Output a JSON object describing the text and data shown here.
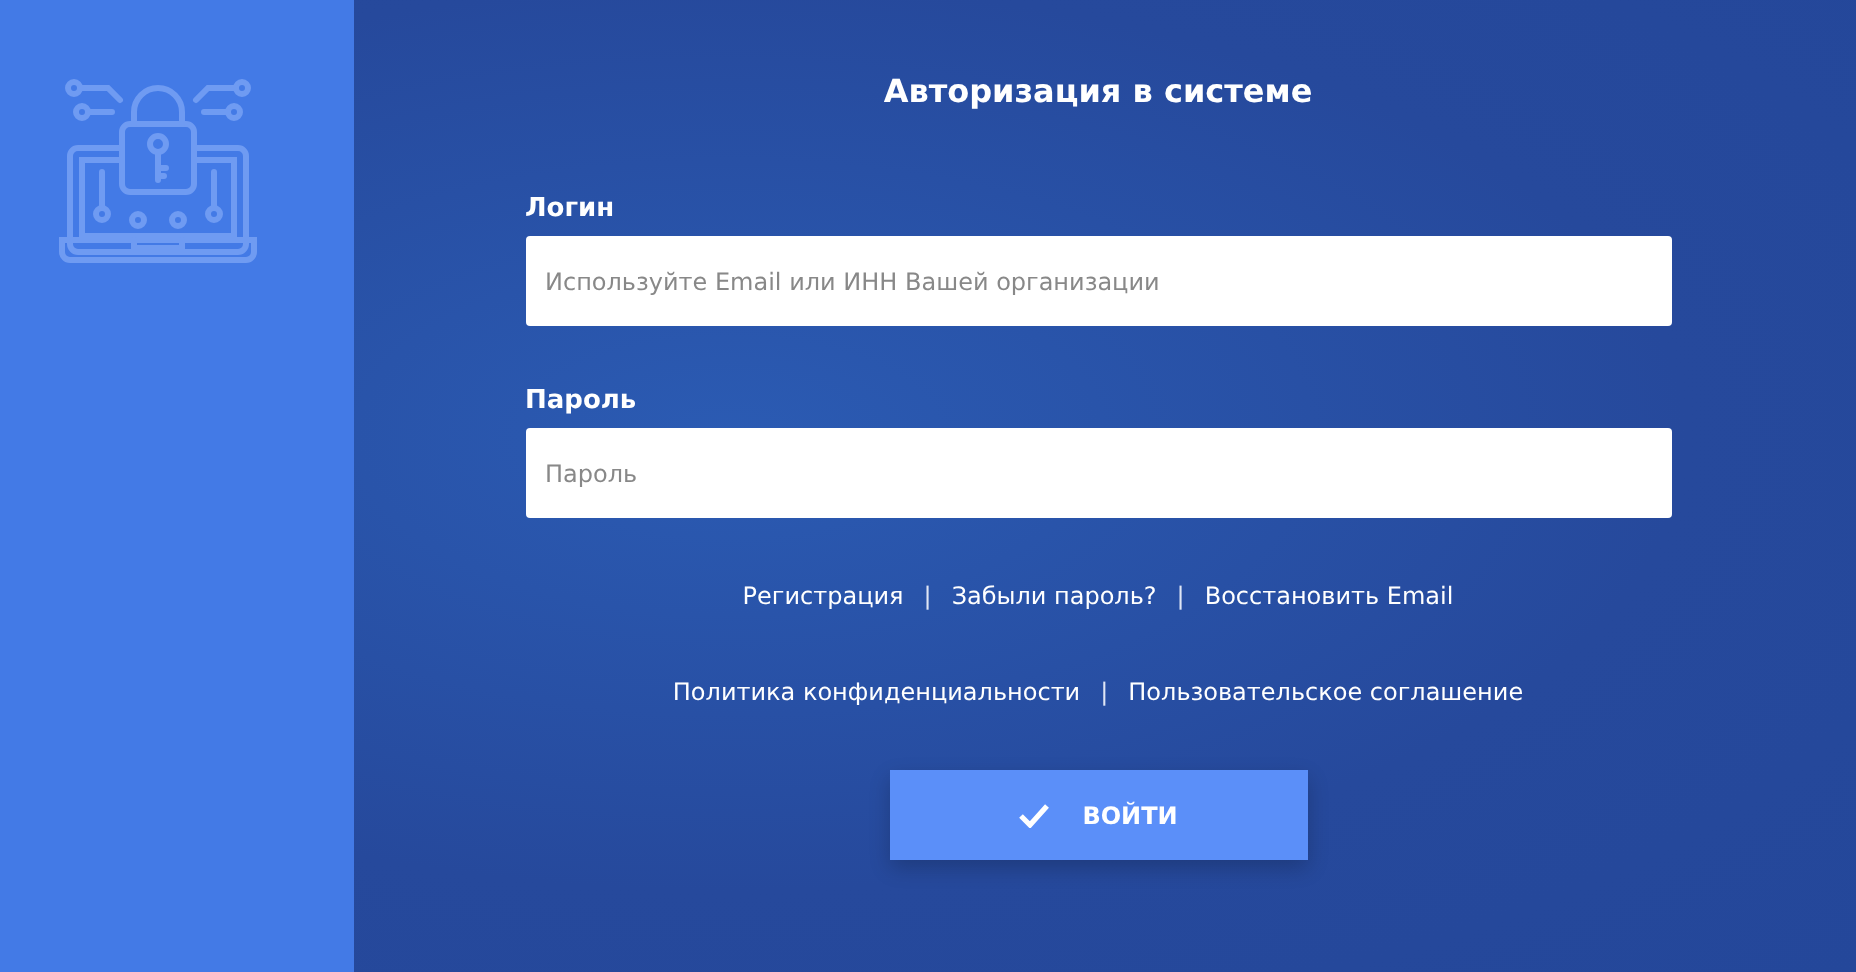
{
  "title": "Авторизация в системе",
  "fields": [
    {
      "label": "Логин",
      "placeholder": "Используйте Email или ИНН Вашей организации"
    },
    {
      "label": "Пароль",
      "placeholder": "Пароль"
    }
  ],
  "link_rows": [
    [
      {
        "kind": "link",
        "text": "Регистрация"
      },
      {
        "kind": "separator",
        "text": "|"
      },
      {
        "kind": "link",
        "text": "Забыли пароль?"
      },
      {
        "kind": "separator",
        "text": "|"
      },
      {
        "kind": "link",
        "text": "Восстановить Email"
      }
    ],
    [
      {
        "kind": "link",
        "text": "Политика конфиденциальности"
      },
      {
        "kind": "separator",
        "text": "|"
      },
      {
        "kind": "link",
        "text": "Пользовательское соглашение"
      }
    ]
  ],
  "submit": "ВОЙТИ"
}
